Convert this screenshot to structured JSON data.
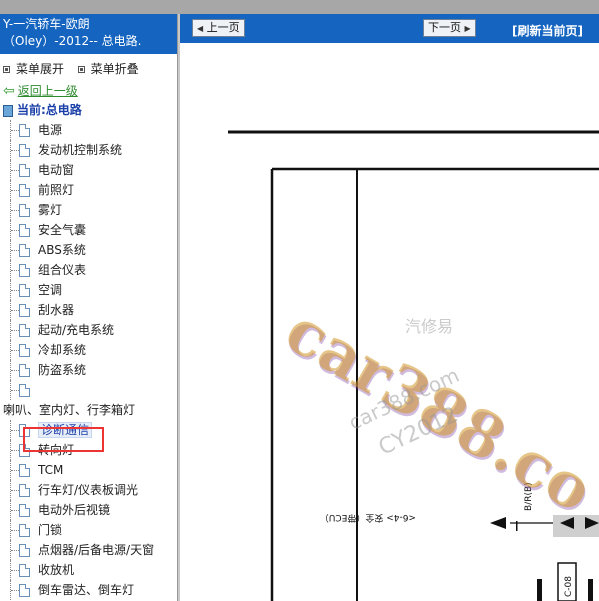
{
  "app": {
    "title_line1": "Y-一汽轿车-欧朗",
    "title_line2": "（Oley）-2012-- 总电路."
  },
  "menu": {
    "expand_label": "菜单展开",
    "collapse_label": "菜单折叠"
  },
  "nav_back": "返回上一级",
  "current": "当前:总电路",
  "tree_items": [
    "电源",
    "发动机控制系统",
    "电动窗",
    "前照灯",
    "雾灯",
    "安全气囊",
    "ABS系统",
    "组合仪表",
    "空调",
    "刮水器",
    "起动/充电系统",
    "冷却系统",
    "防盗系统",
    "",
    "喇叭、室内灯、行李箱灯",
    "诊断通信",
    "转向灯",
    "TCM",
    "行车灯/仪表板调光",
    "电动外后视镜",
    "门锁",
    "点烟器/后备电源/天窗",
    "收放机",
    "倒车雷达、倒车灯"
  ],
  "selected_item": "诊断通信",
  "toolbar": {
    "prev_label": "上一页",
    "next_label": "下一页",
    "refresh_label": "[刷新当前页]"
  },
  "diagram": {
    "watermark_main": "car388.co",
    "watermark_sub1": "car388.com",
    "watermark_sub2": "CY2012",
    "watermark_cn": "汽修易",
    "text_ecu": "<6-4> 安全（带ECU）",
    "wire_label": "B/R(B)",
    "connector_label": "C-08"
  },
  "colors": {
    "header_blue": "#1565c0",
    "selected_box": "#e33333",
    "back_link": "#2e8b2e"
  }
}
